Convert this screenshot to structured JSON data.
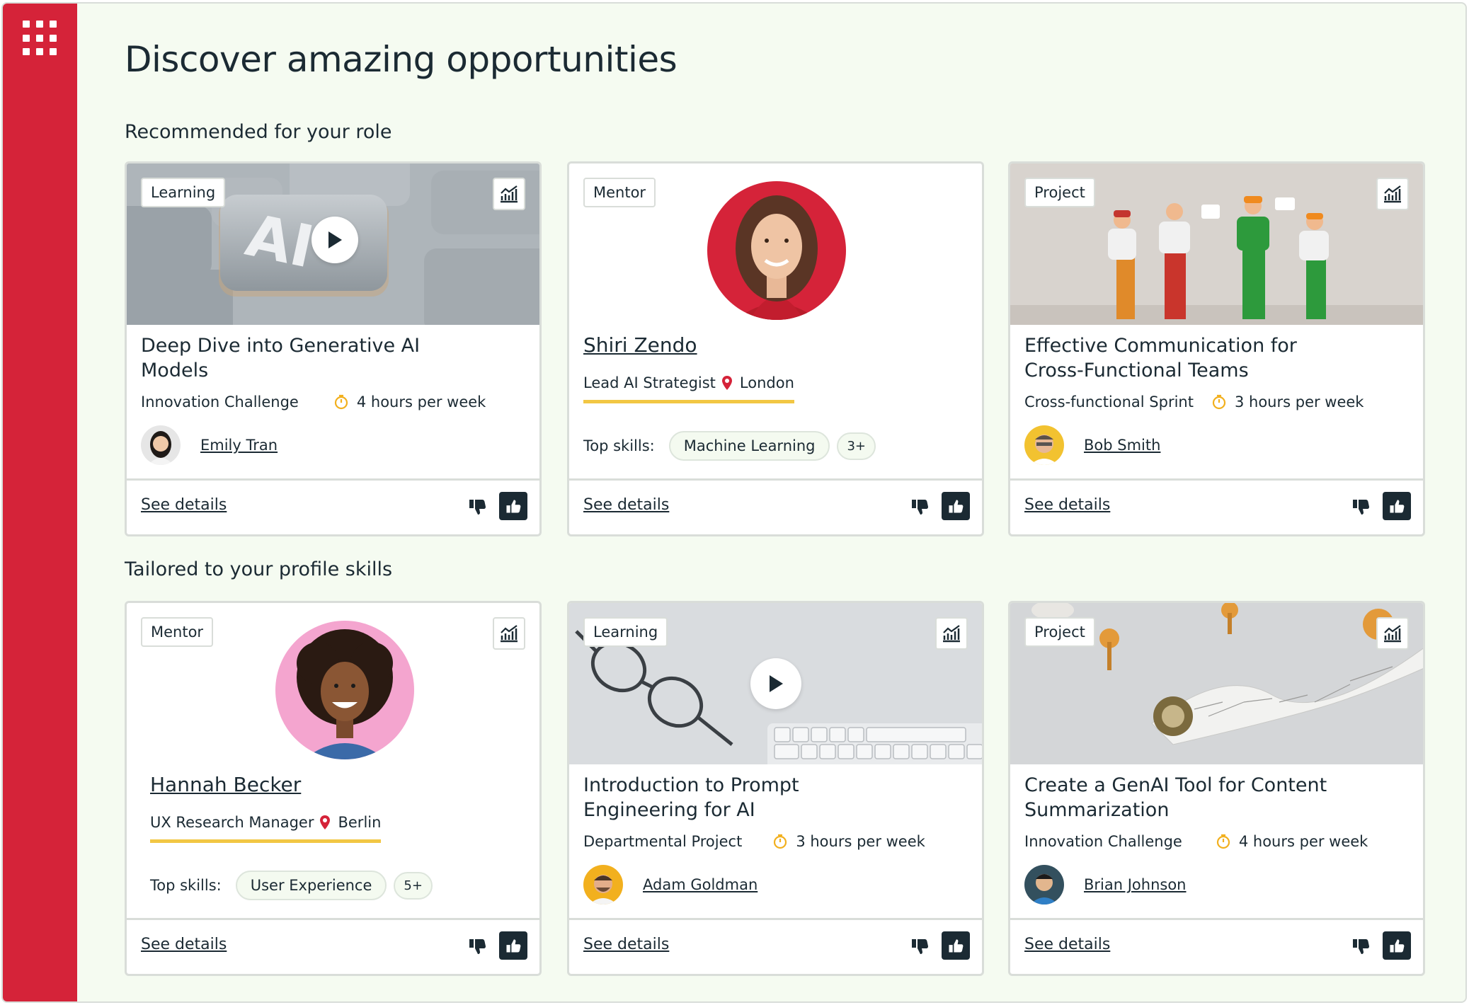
{
  "page": {
    "title": "Discover amazing opportunities"
  },
  "sections": [
    {
      "label": "Recommended for your role"
    },
    {
      "label": "Tailored to your profile skills"
    }
  ],
  "colors": {
    "rail": "#d52339",
    "accent_underline": "#f2c744",
    "like_button": "#1b2a33"
  },
  "cards": [
    {
      "type": "Learning",
      "title": "Deep Dive into Generative AI Models",
      "category": "Innovation Challenge",
      "time": "4 hours per week",
      "person": "Emily Tran",
      "see_details": "See details"
    },
    {
      "type": "Mentor",
      "name": "Shiri Zendo",
      "role": "Lead AI Strategist",
      "location": "London",
      "skills_label": "Top skills:",
      "skill": "Machine Learning",
      "more": "3+",
      "see_details": "See details"
    },
    {
      "type": "Project",
      "title": "Effective Communication for Cross-Functional Teams",
      "category": "Cross-functional Sprint",
      "time": "3 hours per week",
      "person": "Bob Smith",
      "see_details": "See details"
    },
    {
      "type": "Mentor",
      "name": "Hannah Becker",
      "role": "UX Research Manager",
      "location": "Berlin",
      "skills_label": "Top skills:",
      "skill": "User Experience",
      "more": "5+",
      "see_details": "See details"
    },
    {
      "type": "Learning",
      "title": "Introduction to Prompt Engineering for AI",
      "category": "Departmental Project",
      "time": "3 hours per week",
      "person": "Adam Goldman",
      "see_details": "See details"
    },
    {
      "type": "Project",
      "title": "Create a GenAI Tool for Content Summarization",
      "category": "Innovation Challenge",
      "time": "4 hours per week",
      "person": "Brian Johnson",
      "see_details": "See details"
    }
  ]
}
